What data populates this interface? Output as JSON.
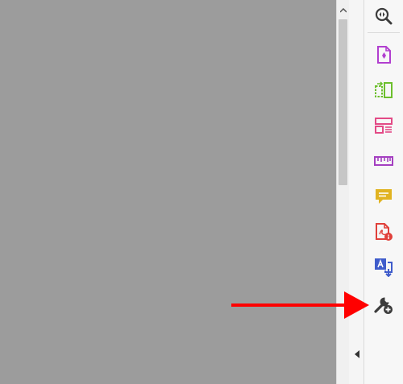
{
  "panel": {
    "tools": [
      {
        "name": "search-zoom-icon",
        "color": "#3c3c3c"
      },
      {
        "name": "create-pdf-icon",
        "color": "#b13fcf"
      },
      {
        "name": "organize-pages-icon",
        "color": "#6cbf2d"
      },
      {
        "name": "edit-pdf-icon",
        "color": "#e34a86"
      },
      {
        "name": "measure-ruler-icon",
        "color": "#a43fc1"
      },
      {
        "name": "comment-icon",
        "color": "#e1b321"
      },
      {
        "name": "export-pdf-icon",
        "color": "#e0403a"
      },
      {
        "name": "translate-icon",
        "color": "#3f5ccb"
      },
      {
        "name": "more-tools-icon",
        "color": "#3c3c3c"
      }
    ]
  },
  "annotation": {
    "arrow_color": "#ff0000",
    "points_to": "more-tools-icon"
  },
  "document": {
    "background": "#9c9c9c"
  }
}
